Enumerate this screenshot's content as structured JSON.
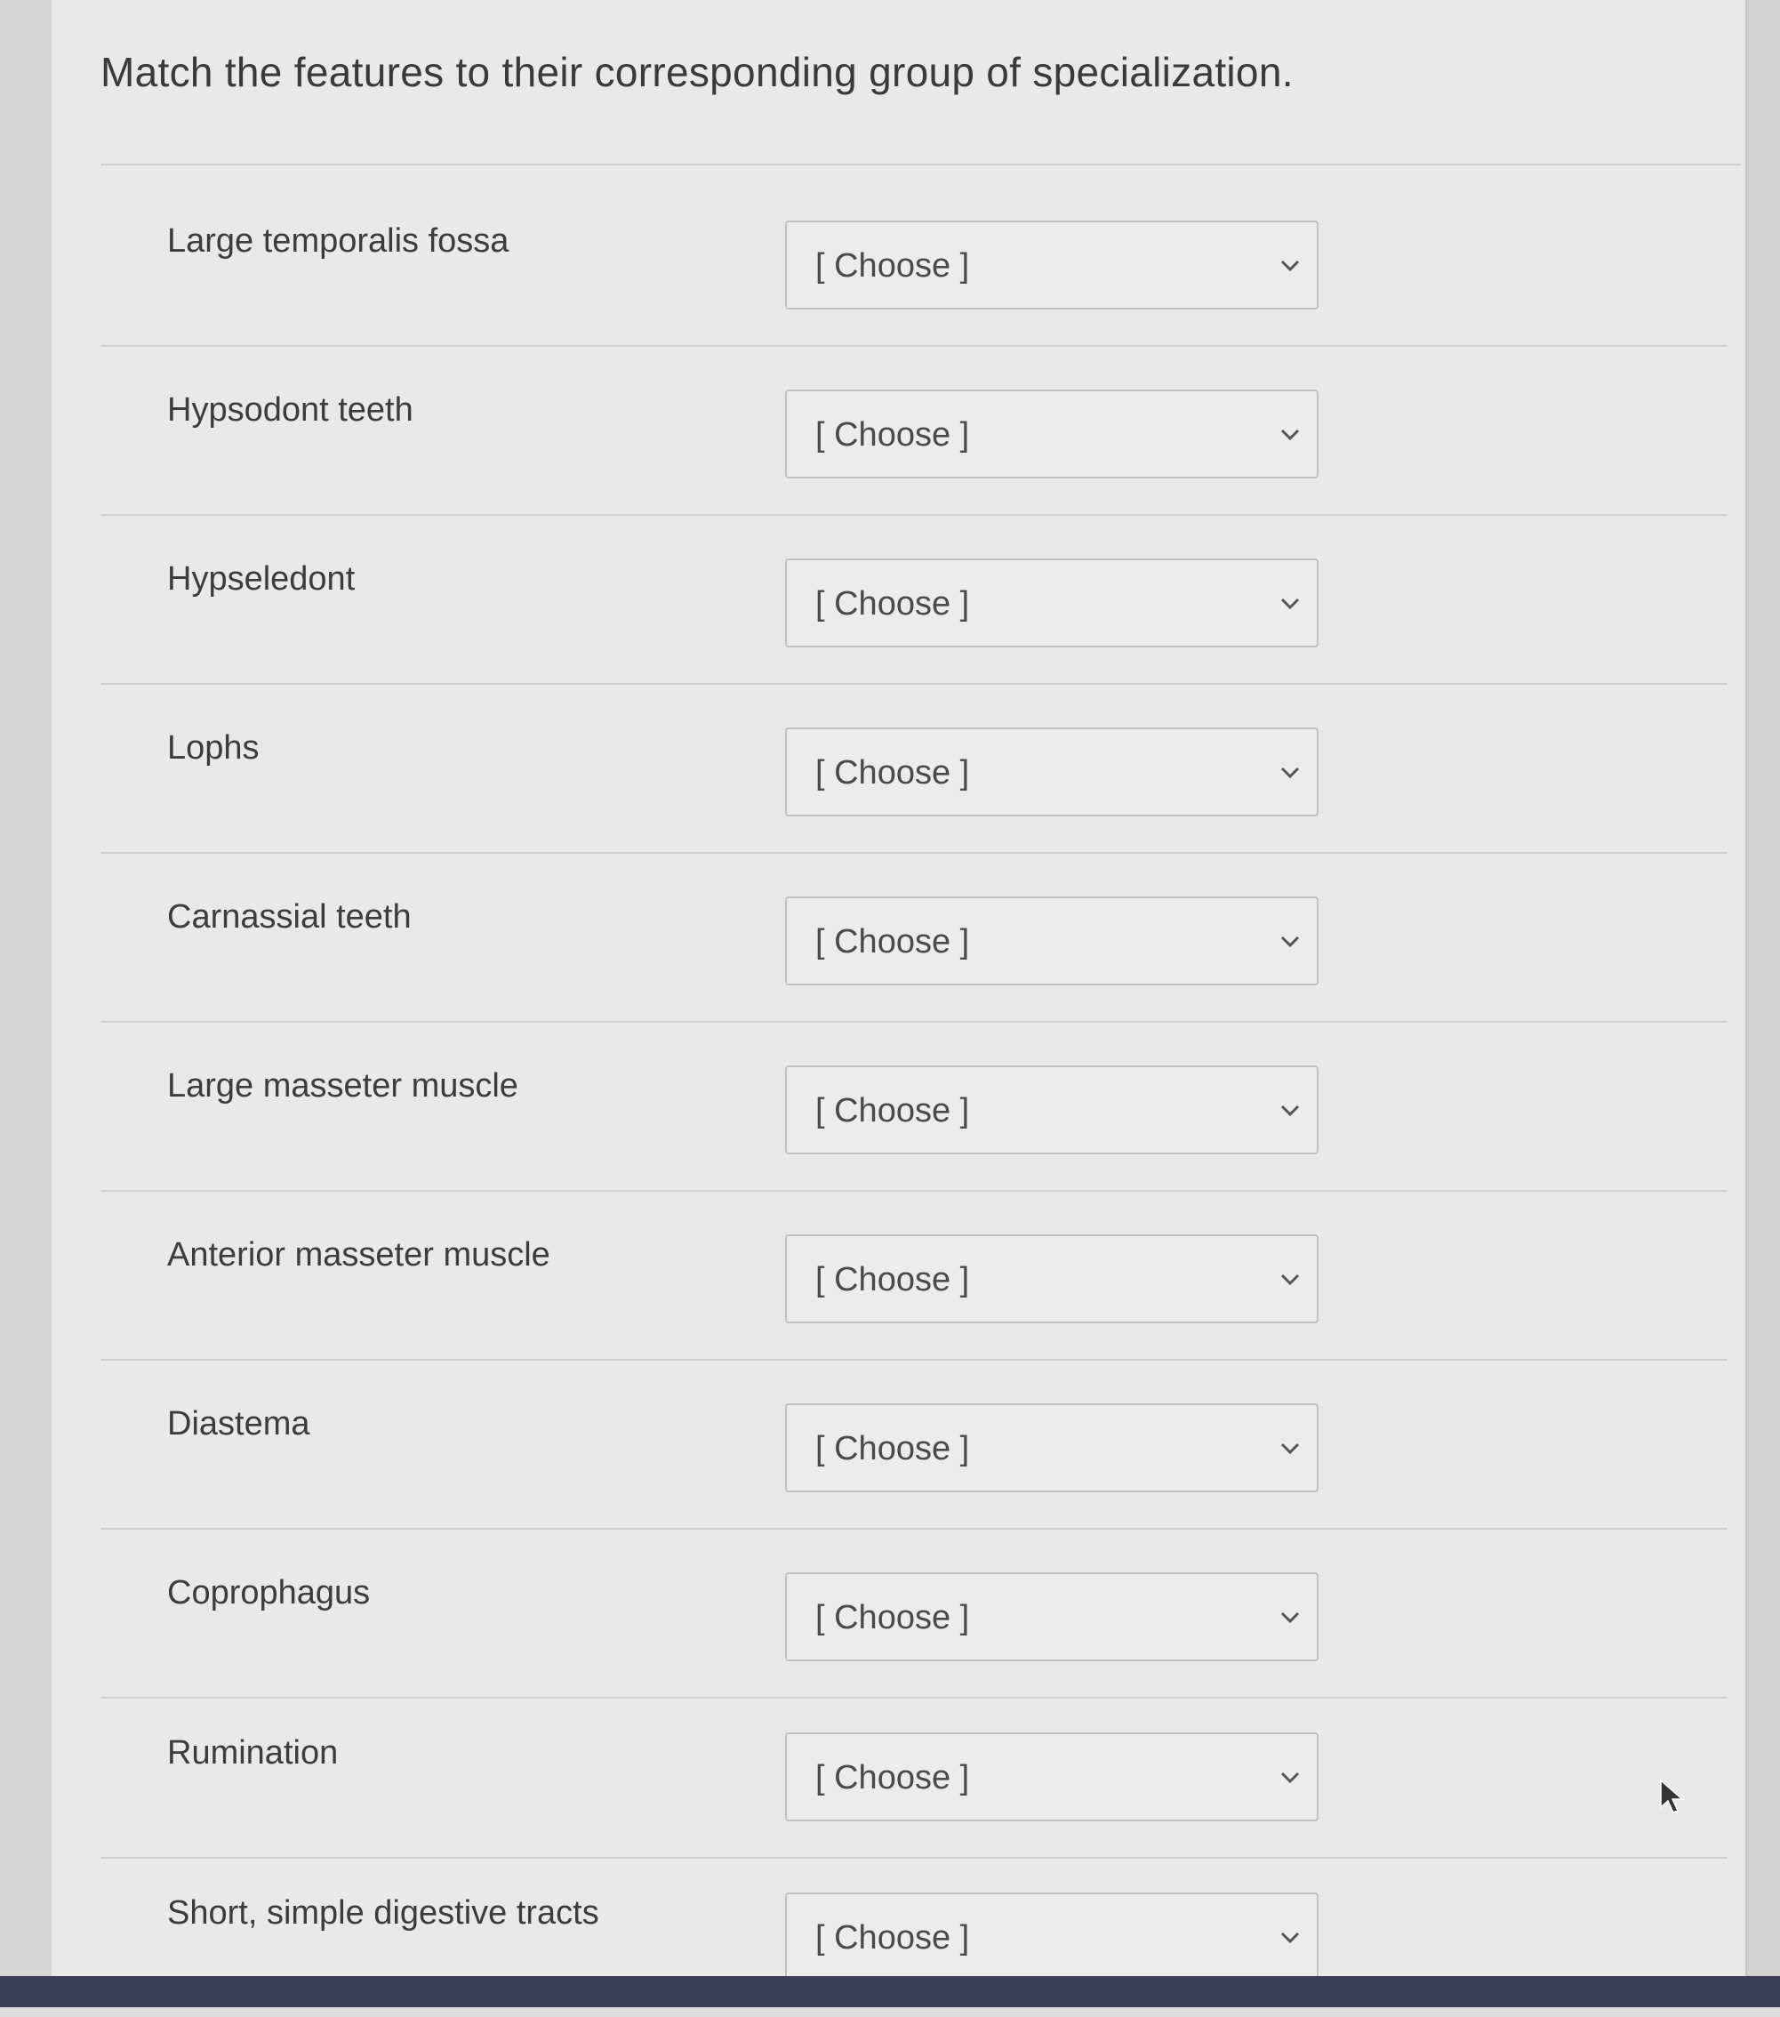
{
  "question": {
    "title": "Match the features to their corresponding group of specialization."
  },
  "rows": [
    {
      "feature": "Large temporalis fossa",
      "selected": "[ Choose ]"
    },
    {
      "feature": "Hypsodont teeth",
      "selected": "[ Choose ]"
    },
    {
      "feature": "Hypseledont",
      "selected": "[ Choose ]"
    },
    {
      "feature": "Lophs",
      "selected": "[ Choose ]"
    },
    {
      "feature": "Carnassial teeth",
      "selected": "[ Choose ]"
    },
    {
      "feature": "Large masseter muscle",
      "selected": "[ Choose ]"
    },
    {
      "feature": "Anterior masseter muscle",
      "selected": "[ Choose ]"
    },
    {
      "feature": "Diastema",
      "selected": "[ Choose ]"
    },
    {
      "feature": "Coprophagus",
      "selected": "[ Choose ]"
    },
    {
      "feature": "Rumination",
      "selected": "[ Choose ]"
    },
    {
      "feature": "Short, simple digestive tracts",
      "selected": "[ Choose ]"
    }
  ],
  "icons": {
    "dropdown": "chevron-down-icon",
    "pointer": "mouse-cursor-icon"
  },
  "colors": {
    "panel_background": "#e9e9e9",
    "bottom_bar": "#3d3f55"
  }
}
